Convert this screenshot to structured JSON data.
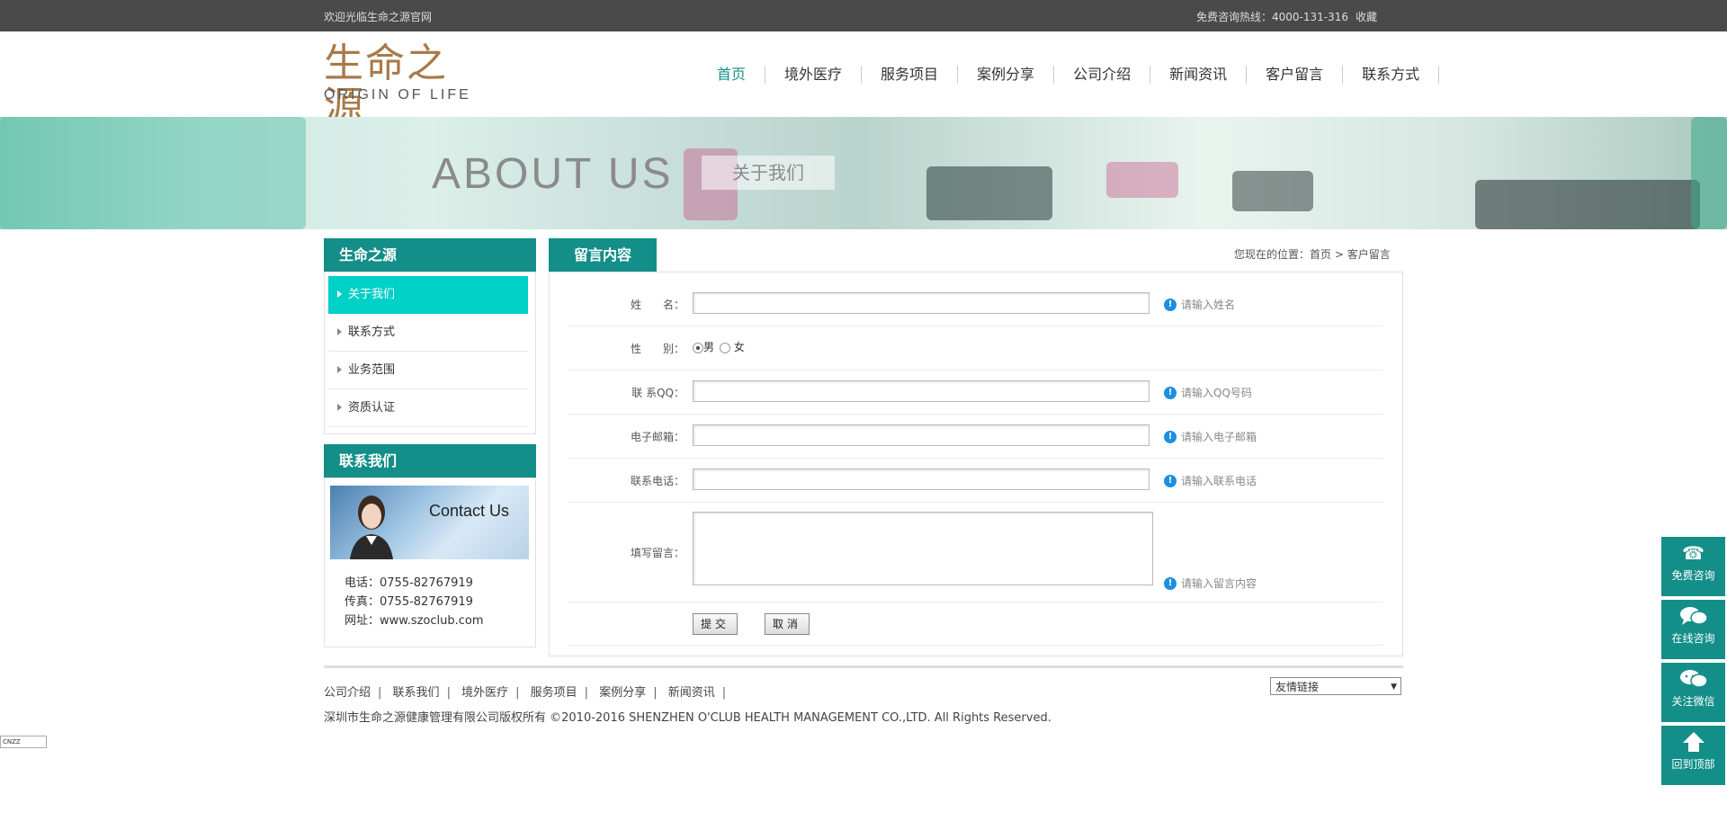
{
  "topbar": {
    "welcome": "欢迎光临生命之源官网",
    "hotline": "免费咨询热线：4000-131-316",
    "favorite": "收藏"
  },
  "logo": {
    "cn": "生命之源",
    "en": "ORIGIN OF LIFE"
  },
  "nav": {
    "items": [
      "首页",
      "境外医疗",
      "服务项目",
      "案例分享",
      "公司介绍",
      "新闻资讯",
      "客户留言",
      "联系方式"
    ],
    "active_index": 0
  },
  "banner": {
    "title_en": "ABOUT US",
    "title_cn": "关于我们"
  },
  "sidebar": {
    "title": "生命之源",
    "items": [
      "关于我们",
      "联系方式",
      "业务范围",
      "资质认证"
    ],
    "contact_title": "联系我们",
    "contact_image_text": "Contact Us",
    "phone": "电话：0755-82767919",
    "fax": "传真：0755-82767919",
    "website": "网址：www.szoclub.com"
  },
  "main": {
    "title": "留言内容",
    "breadcrumb": {
      "prefix": "您现在的位置：",
      "home": "首页",
      "separator": ">",
      "current": "客户留言"
    },
    "form": {
      "name_label": "姓　　名：",
      "name_value": "",
      "name_hint": "请输入姓名",
      "gender_label": "性　　别：",
      "gender_male": "男",
      "gender_female": "女",
      "qq_label": "联 系QQ：",
      "qq_value": "",
      "qq_hint": "请输入QQ号码",
      "email_label": "电子邮箱：",
      "email_value": "",
      "email_hint": "请输入电子邮箱",
      "phone_label": "联系电话：",
      "phone_value": "",
      "phone_hint": "请输入联系电话",
      "message_label": "填写留言：",
      "message_value": "",
      "message_hint": "请输入留言内容",
      "submit": "提交",
      "cancel": "取消"
    }
  },
  "footer": {
    "links": [
      "公司介绍",
      "联系我们",
      "境外医疗",
      "服务项目",
      "案例分享",
      "新闻资讯"
    ],
    "separator": "|",
    "friend_links": "友情链接",
    "copyright": "深圳市生命之源健康管理有限公司版权所有 ©2010-2016 SHENZHEN O'CLUB HEALTH MANAGEMENT CO.,LTD. All Rights Reserved."
  },
  "stat_badge": "CNZZ",
  "float_buttons": [
    {
      "icon": "phone-icon",
      "label": "免费咨询"
    },
    {
      "icon": "chat-icon",
      "label": "在线咨询"
    },
    {
      "icon": "wechat-icon",
      "label": "关注微信"
    },
    {
      "icon": "arrow-up-icon",
      "label": "回到顶部"
    }
  ],
  "colors": {
    "brand": "#138e88",
    "active": "#00d1c7",
    "topbar": "#4a4a4a",
    "logo": "#a87a4a"
  }
}
